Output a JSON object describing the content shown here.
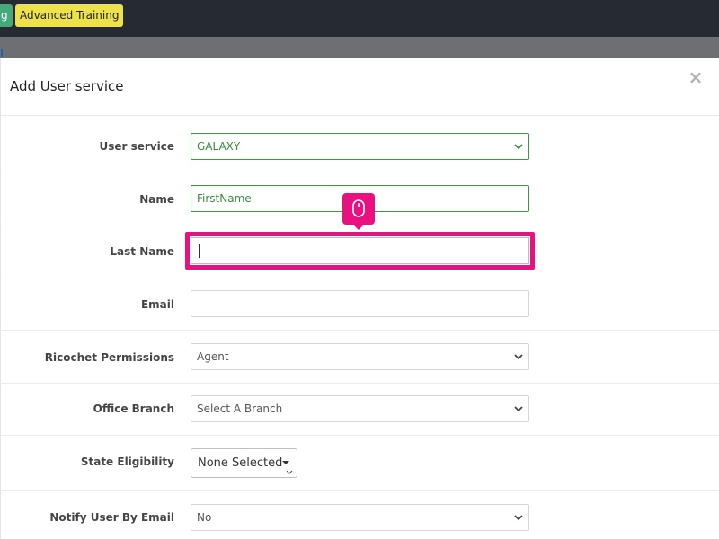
{
  "topbar": {
    "badge_partial": "g",
    "badge_training": "Advanced Training"
  },
  "modal": {
    "title": "Add User service",
    "close_glyph": "×"
  },
  "form": {
    "user_service": {
      "label": "User service",
      "value": "GALAXY"
    },
    "name": {
      "label": "Name",
      "value": "FirstName"
    },
    "last_name": {
      "label": "Last Name",
      "value": ""
    },
    "email": {
      "label": "Email",
      "value": ""
    },
    "ricochet_permissions": {
      "label": "Ricochet Permissions",
      "value": "Agent"
    },
    "office_branch": {
      "label": "Office Branch",
      "value": "Select A Branch"
    },
    "state_eligibility": {
      "label": "State Eligibility",
      "value": "None Selected"
    },
    "notify_user_by_email": {
      "label": "Notify User By Email",
      "value": "No"
    }
  },
  "colors": {
    "accent_pink": "#e8117f",
    "valid_green": "#3c9a3c",
    "topbar": "#252a33",
    "badge_yellow": "#ede24a",
    "badge_green": "#45a97a"
  },
  "icons": {
    "tooltip": "mouse-click-icon",
    "close": "close-icon",
    "select": "chevron-down-icon"
  }
}
